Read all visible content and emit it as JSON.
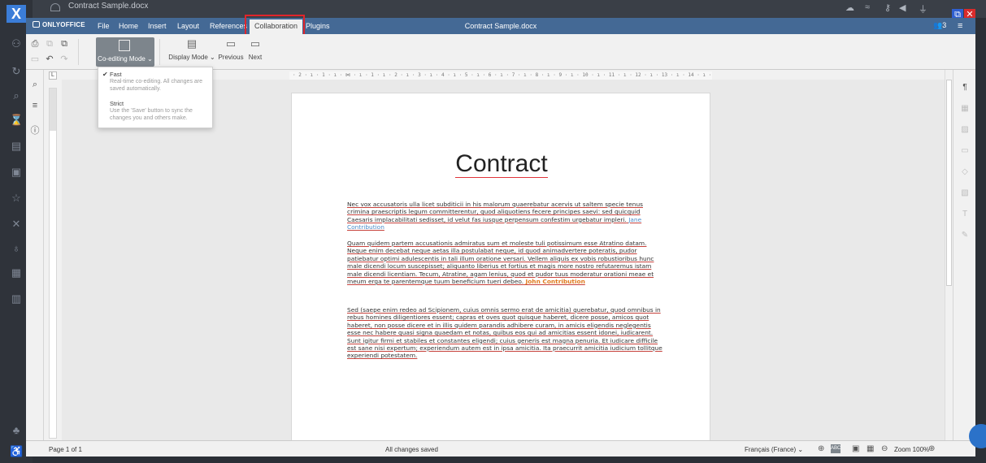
{
  "os": {
    "tab_title": "Contract Sample.docx",
    "logo_glyph": "X",
    "left_icons": [
      "network-icon",
      "search-icon",
      "refresh-icon",
      "hourglass-icon",
      "photo-icon",
      "note-icon",
      "star-icon",
      "cross-icon",
      "bell-icon",
      "calendar-icon",
      "trash-icon",
      "tree-icon",
      "accessibility-icon"
    ]
  },
  "app": {
    "logo": "ONLYOFFICE",
    "document_title": "Contract Sample.docx",
    "user_count": "3",
    "menu": [
      "File",
      "Home",
      "Insert",
      "Layout",
      "References",
      "Collaboration",
      "Plugins"
    ],
    "active_tab": "Collaboration"
  },
  "toolbar": {
    "coedit_label": "Co-editing Mode",
    "display_mode_label": "Display Mode",
    "previous_label": "Previous",
    "next_label": "Next"
  },
  "dropdown": {
    "fast_label": "Fast",
    "fast_desc": "Real-time co-editing. All changes are saved automatically.",
    "strict_label": "Strict",
    "strict_desc": "Use the 'Save' button to sync the changes you and others make."
  },
  "ruler": {
    "tab_symbol": "L",
    "horizontal": "· 2 · ı · 1 · ı · ⋈ · ı · 1 · ı · 2 · ı · 3 · ı · 4 · ı · 5 · ı · 6 · ı · 7 · ı · 8 · ı · 9 · ı · 10 · ı · 11 · ı · 12 · ı · 13 · ı · 14 · ı · 15 · ı · 16 · ı · 17 · ı · 18 ·"
  },
  "document": {
    "heading": "Contract",
    "p1": "Nec vox accusatoris ulla licet subditicii in his malorum quaerebatur acervis ut saltem specie tenus crimina praescriptis legum committerentur, quod aliquotiens fecere principes saevi: sed quicquid Caesaris implacabilitati sedisset, id velut fas iusque perpensum confestim urgebatur impleri.",
    "p1_contributor": "Jane Contribution",
    "p2": "Quam quidem partem accusationis admiratus sum et moleste tuli potissimum esse Atratino datam. Neque enim decebat neque aetas illa postulabat neque, id quod animadvertere poteratis, pudor patiebatur optimi adulescentis in tali illum oratione versari. Vellem aliquis ex vobis robustioribus hunc male dicendi locum suscepisset; aliquanto liberius et fortius et magis more nostro refutaremus istam male dicendi licentiam. Tecum, Atratine, agam lenius, quod et pudor tuus moderatur orationi meae et meum erga te parentemque tuum beneficium tueri debeo.",
    "p2_contributor": "John Contribution",
    "p3": "Sed (saepe enim redeo ad Scipionem, cuius omnis sermo erat de amicitia) querebatur, quod omnibus in rebus homines diligentiores essent; capras et oves quot quisque haberet, dicere posse, amicos quot haberet, non posse dicere et in illis quidem parandis adhibere curam, in amicis eligendis neglegentis esse nec habere quasi signa quaedam et notas, quibus eos qui ad amicitias essent idonei, iudicarent. Sunt igitur firmi et stabiles et constantes eligendi; cuius generis est magna penuria. Et iudicare difficile est sane nisi expertum; experiendum autem est in ipsa amicitia. Ita praecurrit amicitia iudicium tollitque experiendi potestatem."
  },
  "status": {
    "page": "Page 1 of 1",
    "save_state": "All changes saved",
    "language": "Français (France)",
    "spell": "ABC",
    "zoom": "Zoom 100%"
  },
  "colors": {
    "title_bar": "#446995",
    "highlight_box": "#e0252b",
    "contributor_blue": "#4a8bc9",
    "contributor_orange": "#e07a1f",
    "change_underline": "#c7423c"
  }
}
